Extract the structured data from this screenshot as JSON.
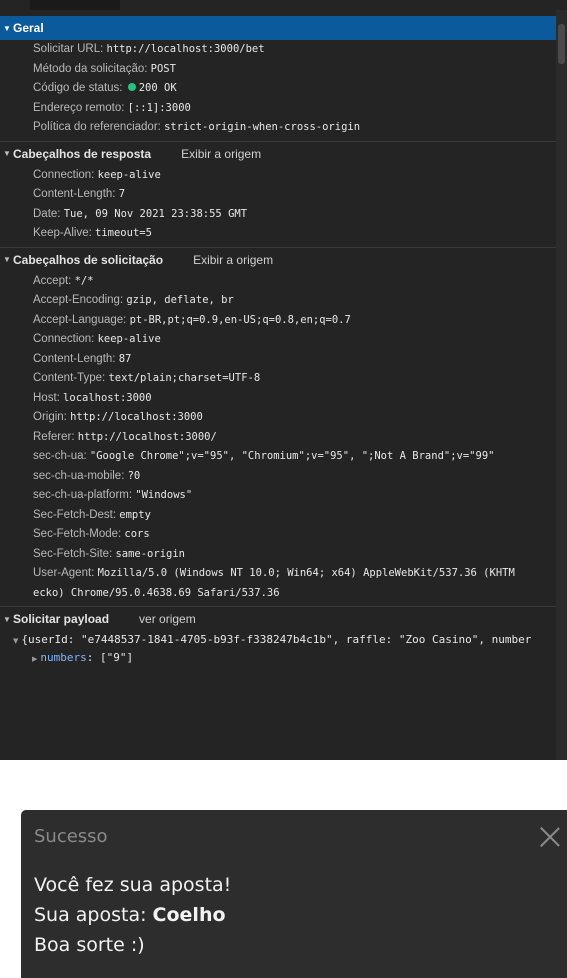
{
  "general": {
    "title": "Geral",
    "rows": [
      {
        "key": "Solicitar URL:",
        "value": "http://localhost:3000/bet"
      },
      {
        "key": "Método da solicitação:",
        "value": "POST"
      },
      {
        "key": "Código de status:",
        "value": "200 OK"
      },
      {
        "key": "Endereço remoto:",
        "value": "[::1]:3000"
      },
      {
        "key": "Política do referenciador:",
        "value": "strict-origin-when-cross-origin"
      }
    ]
  },
  "response_headers": {
    "title": "Cabeçalhos de resposta",
    "view_source": "Exibir a origem",
    "rows": [
      {
        "key": "Connection:",
        "value": "keep-alive"
      },
      {
        "key": "Content-Length:",
        "value": "7"
      },
      {
        "key": "Date:",
        "value": "Tue, 09 Nov 2021 23:38:55 GMT"
      },
      {
        "key": "Keep-Alive:",
        "value": "timeout=5"
      }
    ]
  },
  "request_headers": {
    "title": "Cabeçalhos de solicitação",
    "view_source": "Exibir a origem",
    "rows": [
      {
        "key": "Accept:",
        "value": "*/*"
      },
      {
        "key": "Accept-Encoding:",
        "value": "gzip, deflate, br"
      },
      {
        "key": "Accept-Language:",
        "value": "pt-BR,pt;q=0.9,en-US;q=0.8,en;q=0.7"
      },
      {
        "key": "Connection:",
        "value": "keep-alive"
      },
      {
        "key": "Content-Length:",
        "value": "87"
      },
      {
        "key": "Content-Type:",
        "value": "text/plain;charset=UTF-8"
      },
      {
        "key": "Host:",
        "value": "localhost:3000"
      },
      {
        "key": "Origin:",
        "value": "http://localhost:3000"
      },
      {
        "key": "Referer:",
        "value": "http://localhost:3000/"
      },
      {
        "key": "sec-ch-ua:",
        "value": "\"Google Chrome\";v=\"95\", \"Chromium\";v=\"95\", \";Not A Brand\";v=\"99\""
      },
      {
        "key": "sec-ch-ua-mobile:",
        "value": "?0"
      },
      {
        "key": "sec-ch-ua-platform:",
        "value": "\"Windows\""
      },
      {
        "key": "Sec-Fetch-Dest:",
        "value": "empty"
      },
      {
        "key": "Sec-Fetch-Mode:",
        "value": "cors"
      },
      {
        "key": "Sec-Fetch-Site:",
        "value": "same-origin"
      },
      {
        "key": "User-Agent:",
        "value": "Mozilla/5.0 (Windows NT 10.0; Win64; x64) AppleWebKit/537.36 (KHTM"
      }
    ],
    "user_agent_cont": "ecko) Chrome/95.0.4638.69 Safari/537.36"
  },
  "payload": {
    "title": "Solicitar payload",
    "view_source": "ver origem",
    "summary": "{userId: \"e7448537-1841-4705-b93f-f338247b4c1b\", raffle: \"Zoo Casino\", number",
    "numbers_key": "numbers",
    "numbers_value": "[\"9\"]"
  },
  "toast": {
    "title": "Sucesso",
    "line1": "Você fez sua aposta!",
    "line2_prefix": "Sua aposta: ",
    "line2_bold": "Coelho",
    "line3": "Boa sorte :)"
  },
  "colors": {
    "panel_bg": "#242424",
    "selected_header": "#0b5a9c",
    "status_ok": "#26c281",
    "toast_bg": "#2d2d2d"
  },
  "icons": [
    "expand-triangle-icon",
    "status-ok-dot-icon",
    "close-icon"
  ]
}
